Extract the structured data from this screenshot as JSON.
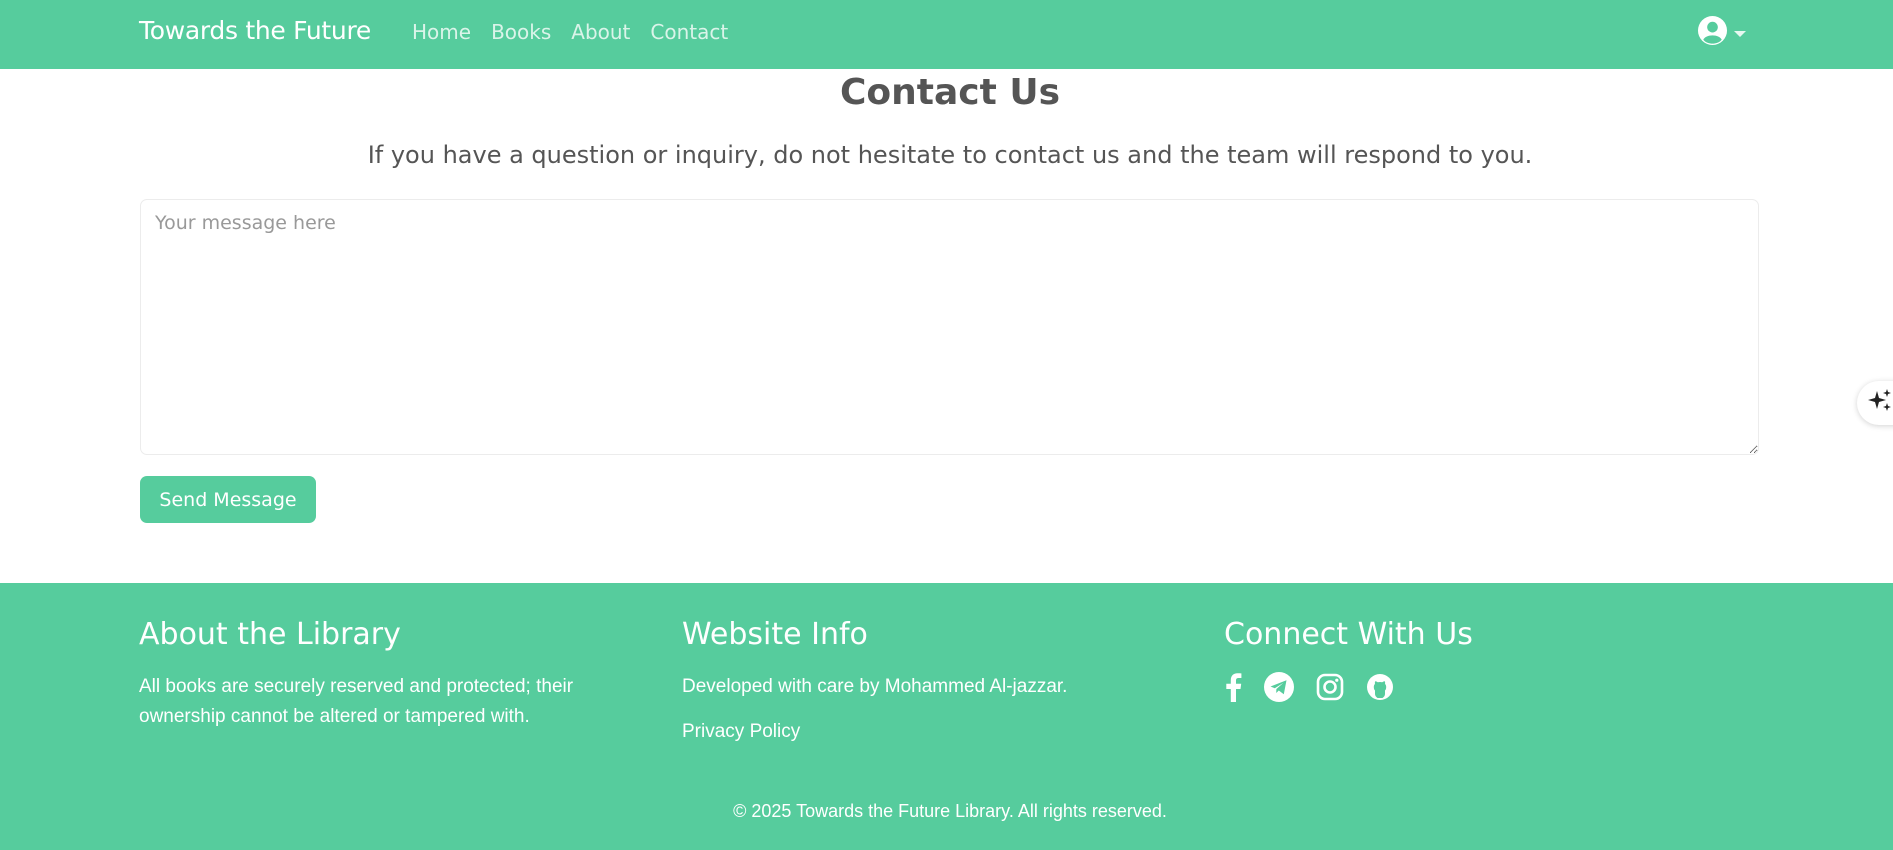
{
  "navbar": {
    "brand": "Towards the Future",
    "links": [
      "Home",
      "Books",
      "About",
      "Contact"
    ],
    "user_icon": "user-circle-icon",
    "user_caret_icon": "caret-down-icon",
    "color": "#56cc9d"
  },
  "contact": {
    "title": "Contact Us",
    "subtitle": "If you have a question or inquiry, do not hesitate to contact us and the team will respond to you.",
    "message_placeholder": "Your message here",
    "message_value": "",
    "send_label": "Send Message"
  },
  "footer": {
    "about": {
      "heading": "About the Library",
      "text": "All books are securely reserved and protected; their ownership cannot be altered or tampered with."
    },
    "info": {
      "heading": "Website Info",
      "text": "Developed with care by Mohammed Al-jazzar.",
      "privacy_link": "Privacy Policy"
    },
    "connect": {
      "heading": "Connect With Us",
      "icons": [
        "facebook-icon",
        "telegram-icon",
        "instagram-icon",
        "github-icon"
      ]
    },
    "copyright": "© 2025 Towards the Future Library. All rights reserved."
  },
  "side_widgets": [
    "sparkle-icon",
    "chatgpt-icon",
    "openai-icon"
  ],
  "colors": {
    "accent": "#56cc9d",
    "text": "#555555",
    "white": "#ffffff"
  }
}
